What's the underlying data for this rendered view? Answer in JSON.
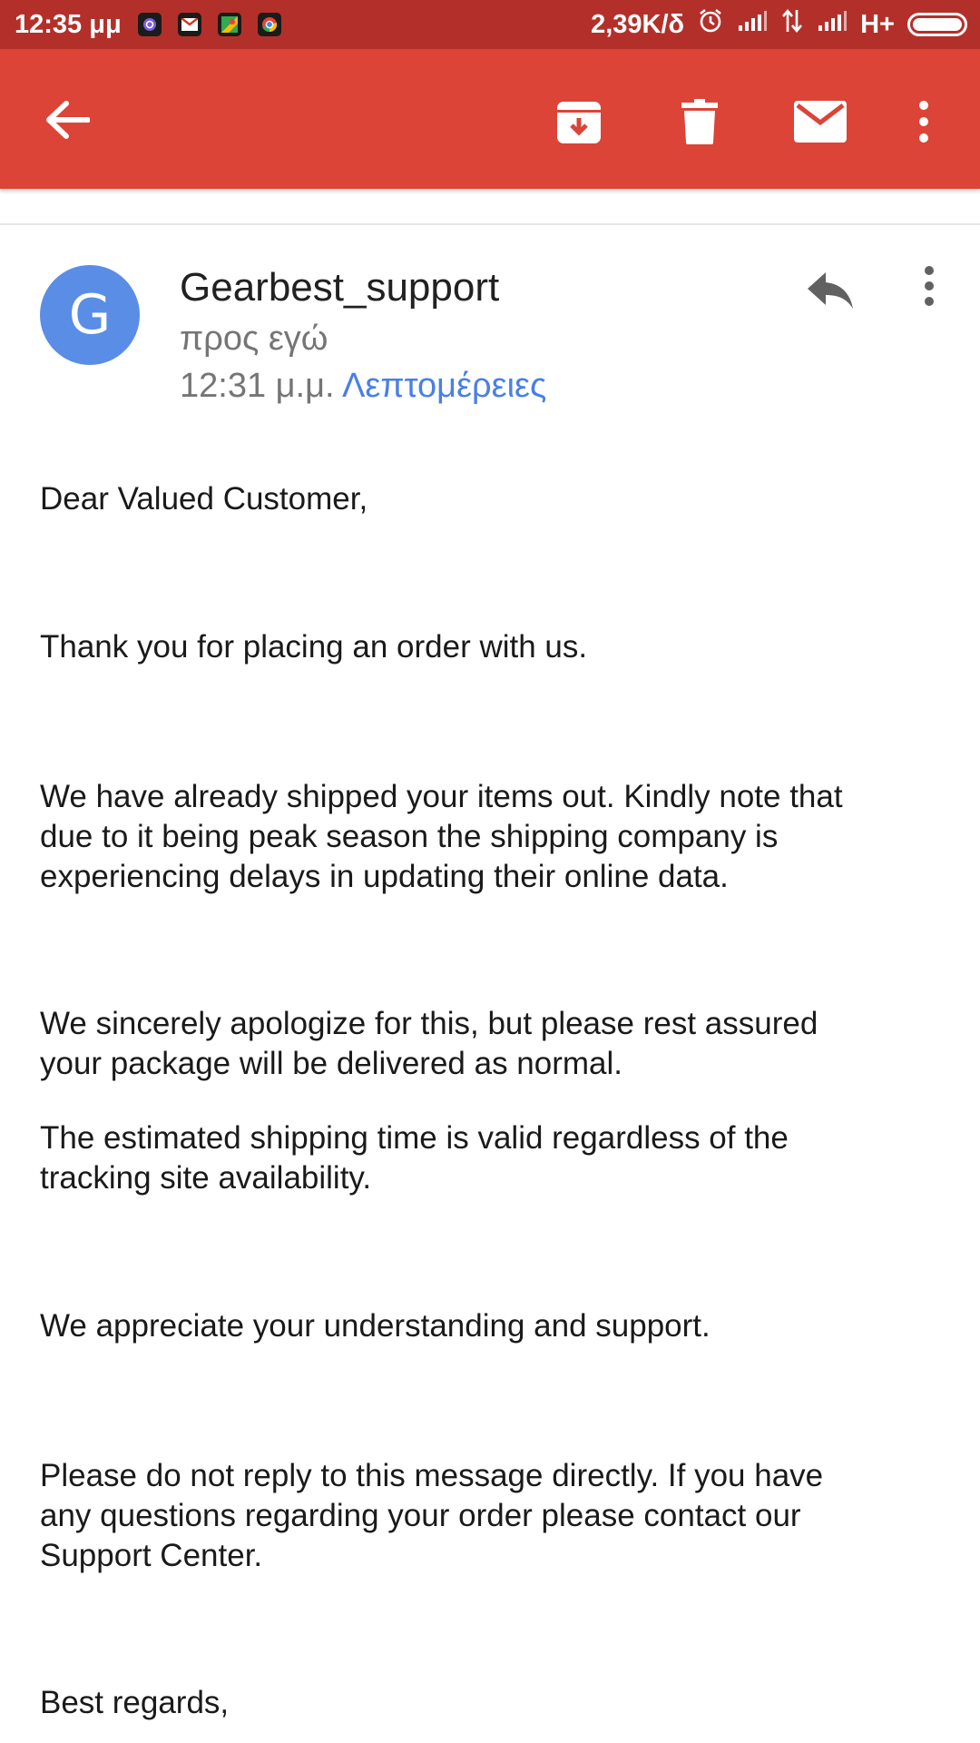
{
  "status_bar": {
    "time": "12:35 μμ",
    "network_speed": "2,39K/δ",
    "network_type": "H+",
    "notification_icons": [
      "viber-icon",
      "gmail-icon",
      "maps-icon",
      "chrome-icon"
    ]
  },
  "toolbar": {
    "actions": [
      "back-arrow-icon",
      "archive-icon",
      "delete-icon",
      "mark-unread-icon",
      "more-vert-icon"
    ]
  },
  "message": {
    "avatar_letter": "G",
    "sender": "Gearbest_support",
    "recipient": "προς εγώ",
    "time": "12:31 μ.μ.",
    "details_label": "Λεπτομέρειες"
  },
  "body": {
    "greeting": "Dear Valued Customer,",
    "p1": "Thank you for placing an order with us.",
    "p2_lines": [
      "We have already shipped your items out. Kindly note that",
      "due to it being peak season the shipping company is",
      "experiencing delays in updating their online data."
    ],
    "p3_lines": [
      "We sincerely apologize for this, but please rest assured",
      "your package will be delivered as normal."
    ],
    "p4_lines": [
      "The estimated shipping time is valid regardless of the",
      "tracking site availability."
    ],
    "p5": "We appreciate your understanding and support.",
    "p6_lines": [
      "Please do not reply to this message directly.  If you have",
      "any questions regarding your order please contact our",
      "Support Center."
    ],
    "closing": "Best regards,"
  },
  "colors": {
    "status_bar": "#b3302a",
    "app_bar": "#db4437",
    "avatar": "#5a8de6",
    "link": "#4a7fe4"
  }
}
